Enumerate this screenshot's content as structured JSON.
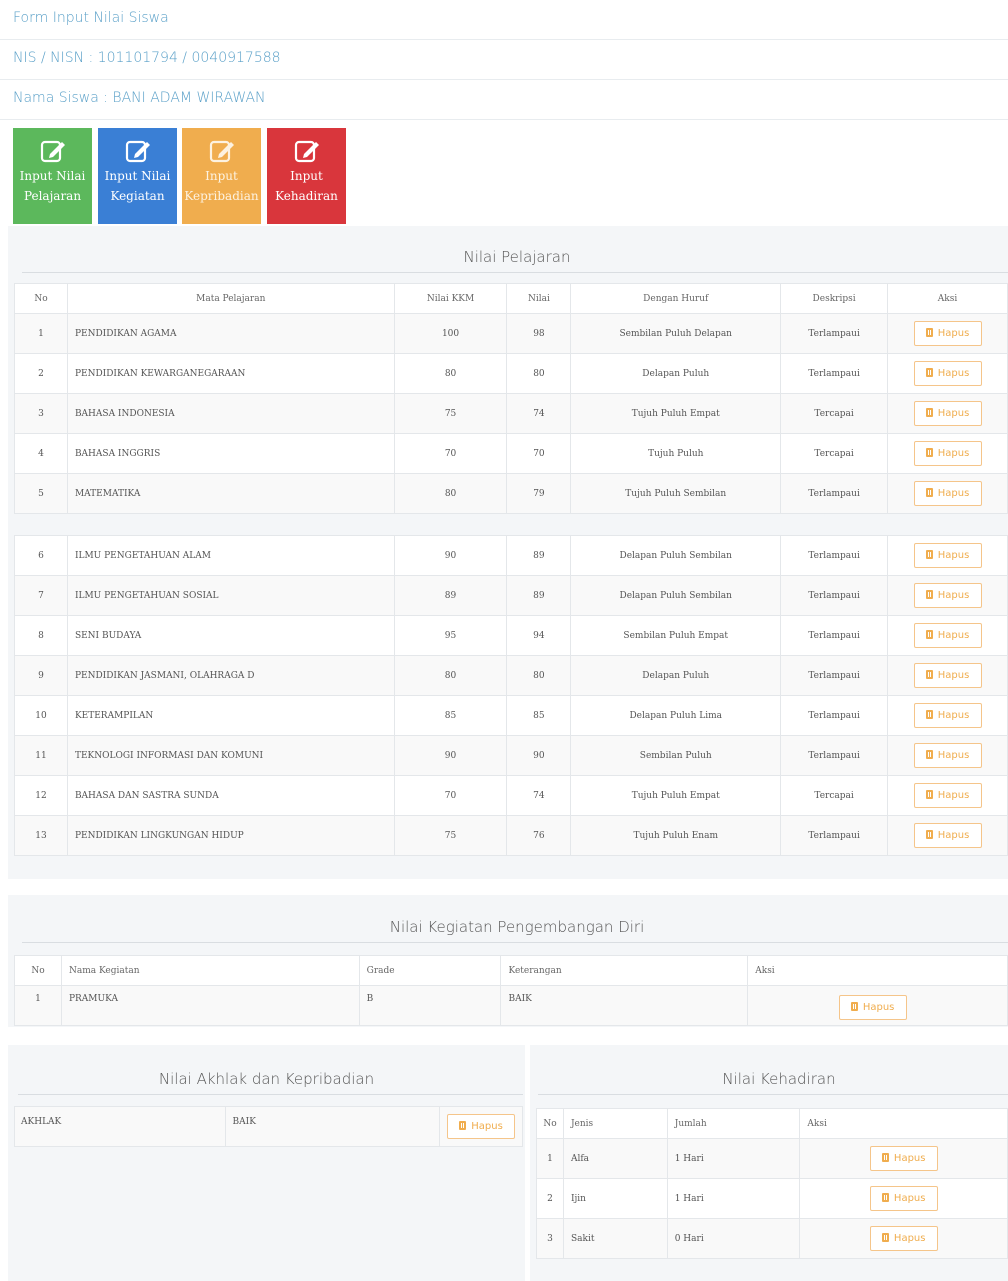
{
  "header": {
    "form_title": "Form Input Nilai Siswa",
    "nis_line": "NIS / NISN : 101101794 / 0040917588",
    "name_line": "Nama Siswa : BANI ADAM WIRAWAN"
  },
  "actions": [
    {
      "line1": "Input Nilai",
      "line2": "Pelajaran"
    },
    {
      "line1": "Input Nilai",
      "line2": "Kegiatan"
    },
    {
      "line1": "Input",
      "line2": "Kepribadian"
    },
    {
      "line1": "Input",
      "line2": "Kehadiran"
    }
  ],
  "colors": {
    "green": "#5cb85c",
    "blue": "#3a7fd5",
    "orange": "#f0ad4e",
    "red": "#d9363c",
    "title_blue": "#5aa0c8"
  },
  "icons": {
    "action": "edit-icon",
    "delete": "trash-icon"
  },
  "delete_label": "Hapus",
  "pelajaran": {
    "title": "Nilai Pelajaran",
    "headers": [
      "No",
      "Mata Pelajaran",
      "Nilai KKM",
      "Nilai",
      "Dengan Huruf",
      "Deskripsi",
      "Aksi"
    ],
    "rows": [
      {
        "no": "1",
        "subject": "PENDIDIKAN AGAMA",
        "kkm": "100",
        "nilai": "98",
        "huruf": "Sembilan Puluh Delapan",
        "desc": "Terlampaui"
      },
      {
        "no": "2",
        "subject": "PENDIDIKAN KEWARGANEGARAAN",
        "kkm": "80",
        "nilai": "80",
        "huruf": "Delapan Puluh",
        "desc": "Terlampaui"
      },
      {
        "no": "3",
        "subject": "BAHASA INDONESIA",
        "kkm": "75",
        "nilai": "74",
        "huruf": "Tujuh Puluh Empat",
        "desc": "Tercapai"
      },
      {
        "no": "4",
        "subject": "BAHASA INGGRIS",
        "kkm": "70",
        "nilai": "70",
        "huruf": "Tujuh Puluh",
        "desc": "Tercapai"
      },
      {
        "no": "5",
        "subject": "MATEMATIKA",
        "kkm": "80",
        "nilai": "79",
        "huruf": "Tujuh Puluh Sembilan",
        "desc": "Terlampaui"
      },
      {
        "no": "6",
        "subject": "ILMU PENGETAHUAN ALAM",
        "kkm": "90",
        "nilai": "89",
        "huruf": "Delapan Puluh Sembilan",
        "desc": "Terlampaui"
      },
      {
        "no": "7",
        "subject": "ILMU PENGETAHUAN SOSIAL",
        "kkm": "89",
        "nilai": "89",
        "huruf": "Delapan Puluh Sembilan",
        "desc": "Terlampaui"
      },
      {
        "no": "8",
        "subject": "SENI BUDAYA",
        "kkm": "95",
        "nilai": "94",
        "huruf": "Sembilan Puluh Empat",
        "desc": "Terlampaui"
      },
      {
        "no": "9",
        "subject": "PENDIDIKAN JASMANI, OLAHRAGA D",
        "kkm": "80",
        "nilai": "80",
        "huruf": "Delapan Puluh",
        "desc": "Terlampaui"
      },
      {
        "no": "10",
        "subject": "KETERAMPILAN",
        "kkm": "85",
        "nilai": "85",
        "huruf": "Delapan Puluh Lima",
        "desc": "Terlampaui"
      },
      {
        "no": "11",
        "subject": "TEKNOLOGI INFORMASI DAN KOMUNI",
        "kkm": "90",
        "nilai": "90",
        "huruf": "Sembilan Puluh",
        "desc": "Terlampaui"
      },
      {
        "no": "12",
        "subject": "BAHASA DAN SASTRA SUNDA",
        "kkm": "70",
        "nilai": "74",
        "huruf": "Tujuh Puluh Empat",
        "desc": "Tercapai"
      },
      {
        "no": "13",
        "subject": "PENDIDIKAN LINGKUNGAN HIDUP",
        "kkm": "75",
        "nilai": "76",
        "huruf": "Tujuh Puluh Enam",
        "desc": "Terlampaui"
      }
    ]
  },
  "kegiatan": {
    "title": "Nilai Kegiatan Pengembangan Diri",
    "headers": [
      "No",
      "Nama Kegiatan",
      "Grade",
      "Keterangan",
      "Aksi"
    ],
    "rows": [
      {
        "no": "1",
        "name": "PRAMUKA",
        "grade": "B",
        "ket": "BAIK"
      }
    ]
  },
  "akhlak": {
    "title": "Nilai Akhlak dan Kepribadian",
    "rows": [
      {
        "label": "AKHLAK",
        "value": "BAIK"
      }
    ]
  },
  "kehadiran": {
    "title": "Nilai Kehadiran",
    "headers": [
      "No",
      "Jenis",
      "Jumlah",
      "Aksi"
    ],
    "rows": [
      {
        "no": "1",
        "jenis": "Alfa",
        "jumlah": "1 Hari"
      },
      {
        "no": "2",
        "jenis": "Ijin",
        "jumlah": "1 Hari"
      },
      {
        "no": "3",
        "jenis": "Sakit",
        "jumlah": "0 Hari"
      }
    ]
  }
}
